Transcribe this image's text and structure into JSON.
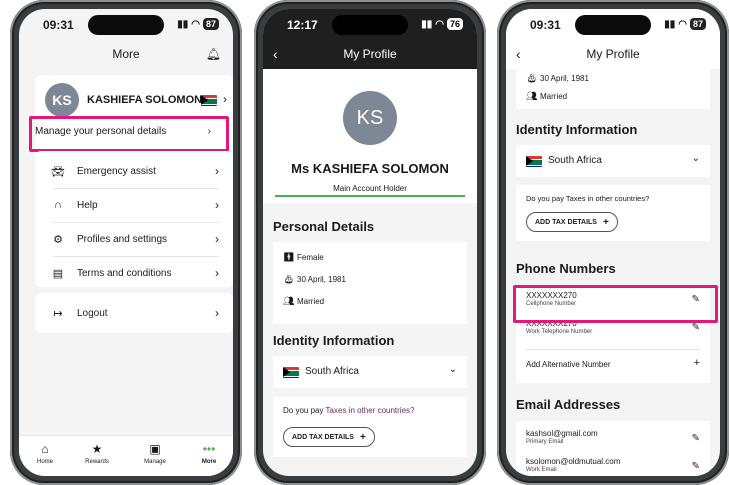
{
  "phone1": {
    "status_time": "09:31",
    "battery": "87",
    "header_title": "More",
    "profile": {
      "initials": "KS",
      "name": "KASHIEFA SOLOMON"
    },
    "manage_label": "Manage your personal details",
    "menu": [
      {
        "label": "Emergency assist",
        "icon": "car-icon"
      },
      {
        "label": "Help",
        "icon": "headset-icon"
      },
      {
        "label": "Profiles and settings",
        "icon": "gear-icon"
      },
      {
        "label": "Terms and conditions",
        "icon": "document-icon"
      }
    ],
    "logout_label": "Logout",
    "tabs": [
      {
        "label": "Home",
        "icon": "home-icon"
      },
      {
        "label": "Rewards",
        "icon": "star-icon"
      },
      {
        "label": "Manage",
        "icon": "briefcase-icon"
      },
      {
        "label": "More",
        "icon": "more-icon"
      }
    ]
  },
  "phone2": {
    "status_time": "12:17",
    "battery": "76",
    "header_title": "My Profile",
    "initials": "KS",
    "full_name": "Ms KASHIEFA SOLOMON",
    "role": "Main Account Holder",
    "personal_details_title": "Personal Details",
    "gender": "Female",
    "birth_date": "30 April, 1981",
    "marital_status": "Married",
    "identity_title": "Identity Information",
    "country": "South Africa",
    "tax_question_prefix": "Do you pay ",
    "tax_question_highlight": "Taxes in other countries?",
    "add_tax_label": "ADD TAX DETAILS"
  },
  "phone3": {
    "status_time": "09:31",
    "battery": "87",
    "header_title": "My Profile",
    "birth_date": "30 April, 1981",
    "marital_status": "Married",
    "identity_title": "Identity Information",
    "country": "South Africa",
    "tax_question": "Do you pay Taxes in other countries?",
    "add_tax_label": "ADD TAX DETAILS",
    "phone_title": "Phone Numbers",
    "phones": [
      {
        "number": "XXXXXXX270",
        "type": "Cellphone Number"
      },
      {
        "number": "XXXXXXX270",
        "type": "Work Telephone Number"
      }
    ],
    "add_alt_label": "Add Alternative Number",
    "email_title": "Email Addresses",
    "emails": [
      {
        "address": "kashsol@gmail.com",
        "type": "Primary Email"
      },
      {
        "address": "ksolomon@oldmutual.com",
        "type": "Work Email"
      }
    ]
  },
  "colors": {
    "highlight": "#e4187a",
    "accent_green": "#4caf50",
    "avatar_grey": "#7d8795"
  }
}
